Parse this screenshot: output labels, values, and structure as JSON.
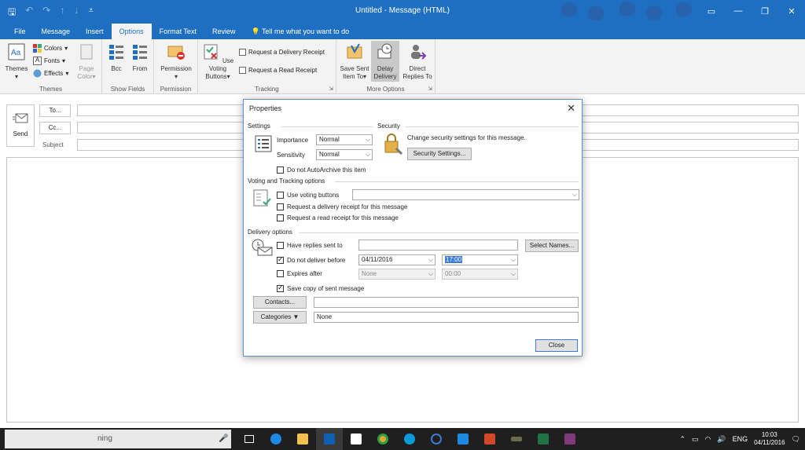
{
  "window": {
    "title": "Untitled - Message (HTML)"
  },
  "tabs": [
    "File",
    "Message",
    "Insert",
    "Options",
    "Format Text",
    "Review"
  ],
  "active_tab": "Options",
  "tell_me": "Tell me what you want to do",
  "ribbon": {
    "themes": {
      "themes_label": "Themes",
      "colors_label": "Colors",
      "fonts_label": "Fonts",
      "effects_label": "Effects",
      "page_color_label": "Page Color",
      "group_label": "Themes"
    },
    "show_fields": {
      "bcc_label": "Bcc",
      "from_label": "From",
      "group_label": "Show Fields"
    },
    "permission": {
      "permission_label": "Permission",
      "group_label": "Permission"
    },
    "tracking": {
      "voting_label": "Use Voting Buttons",
      "delivery_receipt_label": "Request a Delivery Receipt",
      "read_receipt_label": "Request a Read Receipt",
      "group_label": "Tracking"
    },
    "more_options": {
      "save_sent_label": "Save Sent Item To",
      "delay_label": "Delay Delivery",
      "direct_replies_label": "Direct Replies To",
      "group_label": "More Options"
    }
  },
  "compose": {
    "send_label": "Send",
    "to_label": "To...",
    "cc_label": "Cc...",
    "subject_label": "Subject"
  },
  "dialog": {
    "title": "Properties",
    "settings_label": "Settings",
    "security_label": "Security",
    "importance_label": "Importance",
    "importance_value": "Normal",
    "sensitivity_label": "Sensitivity",
    "sensitivity_value": "Normal",
    "security_text": "Change security settings for this message.",
    "security_button": "Security Settings...",
    "no_autoarchive_label": "Do not AutoArchive this item",
    "voting_section_label": "Voting and Tracking options",
    "use_voting_label": "Use voting buttons",
    "delivery_receipt_label": "Request a delivery receipt for this message",
    "read_receipt_label": "Request a read receipt for this message",
    "delivery_section_label": "Delivery options",
    "have_replies_label": "Have replies sent to",
    "select_names_button": "Select Names...",
    "do_not_deliver_label": "Do not deliver before",
    "deliver_date": "04/11/2016",
    "deliver_time": "17:00",
    "expires_label": "Expires after",
    "expires_date": "None",
    "expires_time": "00:00",
    "save_copy_label": "Save copy of sent message",
    "contacts_button": "Contacts...",
    "categories_button": "Categories",
    "categories_value": "None",
    "close_button": "Close"
  },
  "taskbar": {
    "search_text": "ning",
    "language": "ENG",
    "time": "10:03",
    "date": "04/11/2016"
  },
  "colors": {
    "accent": "#1e6fc1",
    "taskbar": "#1f1f1f"
  }
}
